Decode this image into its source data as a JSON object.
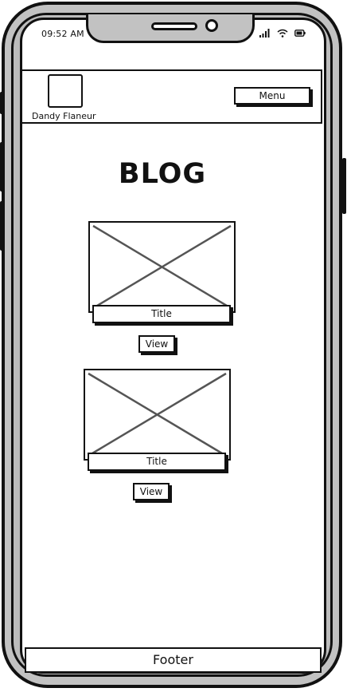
{
  "status_bar": {
    "time": "09:52 AM",
    "icons": [
      "signal-icon",
      "wifi-icon",
      "battery-icon"
    ]
  },
  "header": {
    "site_name": "Dandy Flaneur",
    "menu_label": "Menu"
  },
  "main": {
    "title": "BLOG",
    "posts": [
      {
        "title": "Title",
        "view_label": "View"
      },
      {
        "title": "Title",
        "view_label": "View"
      }
    ]
  },
  "footer": {
    "label": "Footer"
  }
}
